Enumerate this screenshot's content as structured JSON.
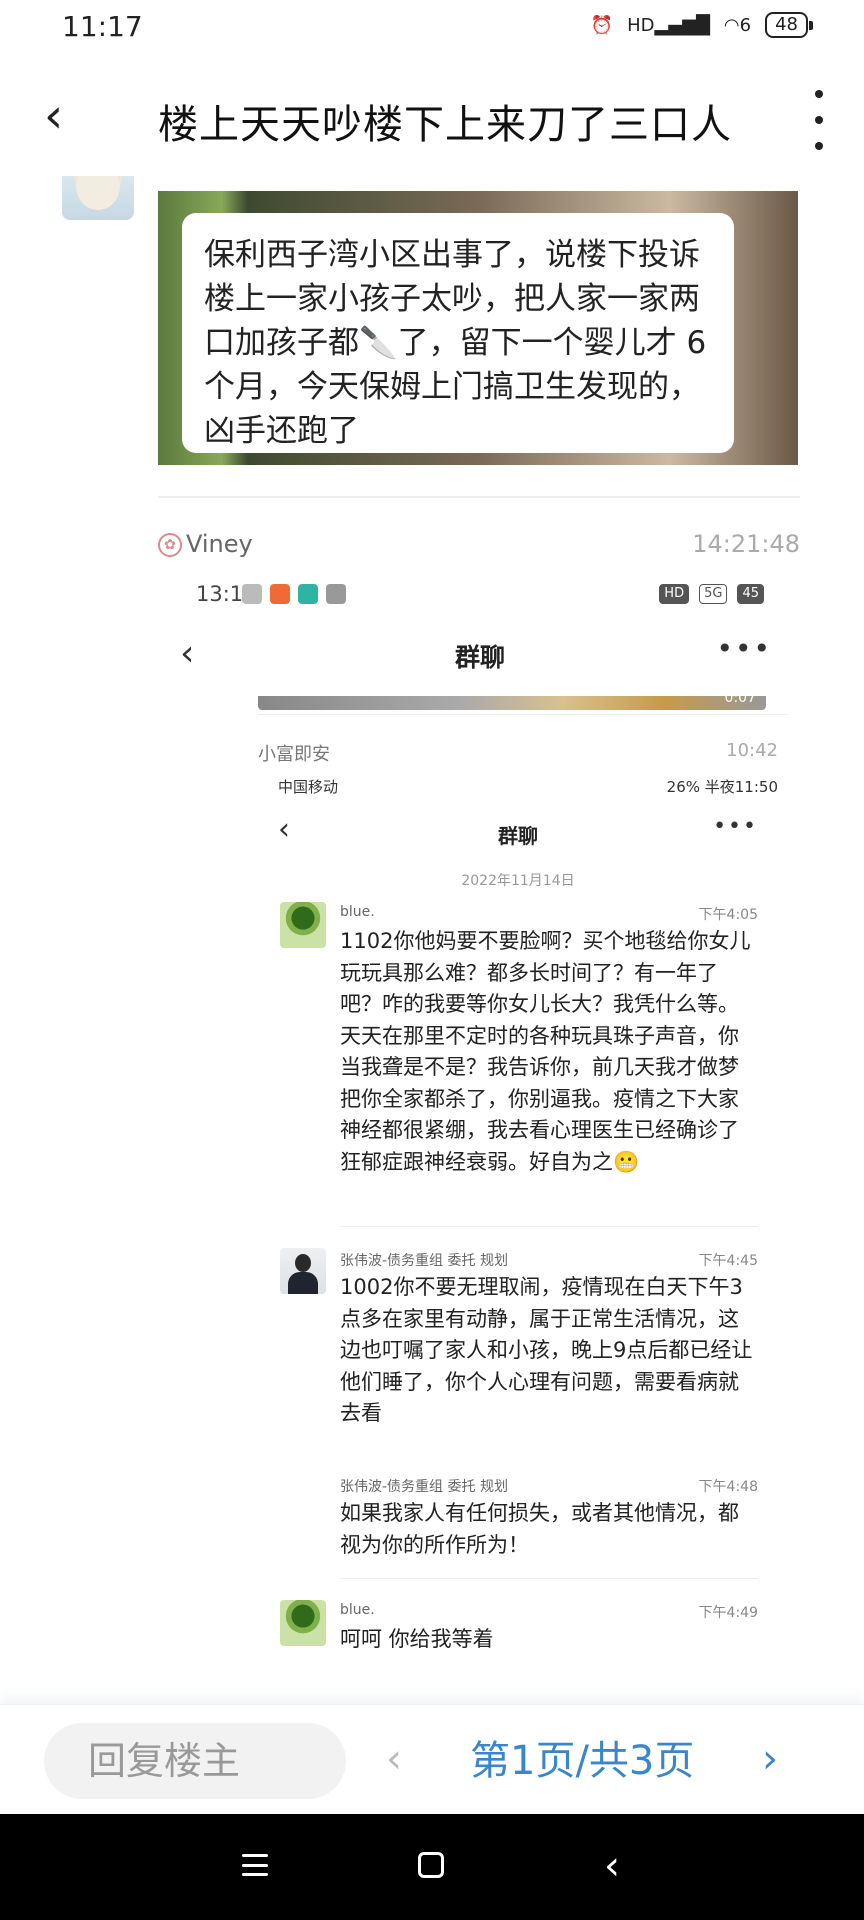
{
  "status": {
    "time": "11:17",
    "hd": "HD",
    "network": "6",
    "battery": "48"
  },
  "header": {
    "title": "楼上天天吵楼下上来刀了三口人"
  },
  "post": {
    "image_text": "保利西子湾小区出事了，说楼下投诉楼上一家小孩子太吵，把人家一家两口加孩子都🔪了，留下一个婴儿才 6 个月，今天保姆上门搞卫生发现的，凶手还跑了"
  },
  "reply": {
    "user": "Viney",
    "time": "14:21:48"
  },
  "screenshot": {
    "status_time": "13:15",
    "status_right": {
      "hd": "HD",
      "net": "5G",
      "battery": "45"
    },
    "nav_title": "群聊",
    "video_duration": "0:07",
    "reply_user": "小富即安",
    "reply_time": "10:42",
    "inner": {
      "status_left": "中国移动",
      "status_right": "26% 半夜11:50",
      "nav_title": "群聊",
      "date": "2022年11月14日",
      "messages": [
        {
          "name": "blue.",
          "time": "下午4:05",
          "text": "1102你他妈要不要脸啊？买个地毯给你女儿玩玩具那么难？都多长时间了？有一年了吧？咋的我要等你女儿长大？我凭什么等。天天在那里不定时的各种玩具珠子声音，你当我聋是不是？我告诉你，前几天我才做梦把你全家都杀了，你别逼我。疫情之下大家神经都很紧绷，我去看心理医生已经确诊了狂郁症跟神经衰弱。好自为之😬"
        },
        {
          "name": "张伟波-债务重组 委托 规划",
          "time": "下午4:45",
          "text": "1002你不要无理取闹，疫情现在白天下午3点多在家里有动静，属于正常生活情况，这边也叮嘱了家人和小孩，晚上9点后都已经让他们睡了，你个人心理有问题，需要看病就去看"
        },
        {
          "name": "张伟波-债务重组 委托 规划",
          "time": "下午4:48",
          "text": "如果我家人有任何损失，或者其他情况，都视为你的所作所为！"
        },
        {
          "name": "blue.",
          "time": "下午4:49",
          "text": "呵呵 你给我等着"
        }
      ]
    }
  },
  "bottom": {
    "reply_placeholder": "回复楼主",
    "prev": "‹",
    "page_info": "第1页/共3页",
    "next": "›"
  },
  "icons": {
    "back": "chevron-left-icon",
    "more": "more-vertical-icon",
    "nav_menu": "menu-icon",
    "nav_home": "home-icon",
    "nav_back": "back-icon"
  },
  "colors": {
    "accent": "#3a86c8"
  }
}
